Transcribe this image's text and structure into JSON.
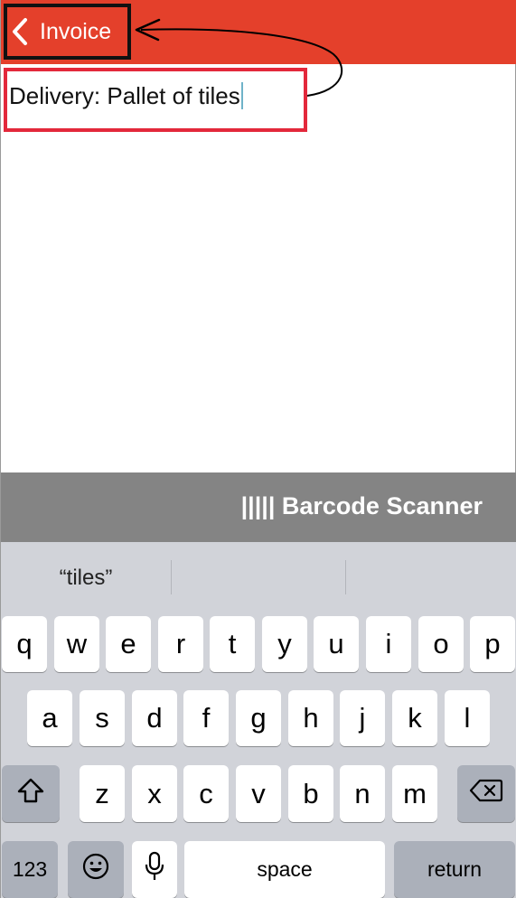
{
  "navbar": {
    "back_label": "Invoice",
    "accent_color": "#e4402b"
  },
  "text_field": {
    "value": "Delivery: Pallet of tiles"
  },
  "accessory": {
    "barcode_label": "||||| Barcode Scanner"
  },
  "keyboard": {
    "suggestions": [
      "“tiles”",
      "",
      ""
    ],
    "row1": [
      "q",
      "w",
      "e",
      "r",
      "t",
      "y",
      "u",
      "i",
      "o",
      "p"
    ],
    "row2": [
      "a",
      "s",
      "d",
      "f",
      "g",
      "h",
      "j",
      "k",
      "l"
    ],
    "row3": [
      "z",
      "x",
      "c",
      "v",
      "b",
      "n",
      "m"
    ],
    "numbers_label": "123",
    "space_label": "space",
    "return_label": "return",
    "icons": {
      "shift": "shift-icon",
      "delete": "delete-icon",
      "emoji": "emoji-icon",
      "mic": "microphone-icon"
    }
  }
}
